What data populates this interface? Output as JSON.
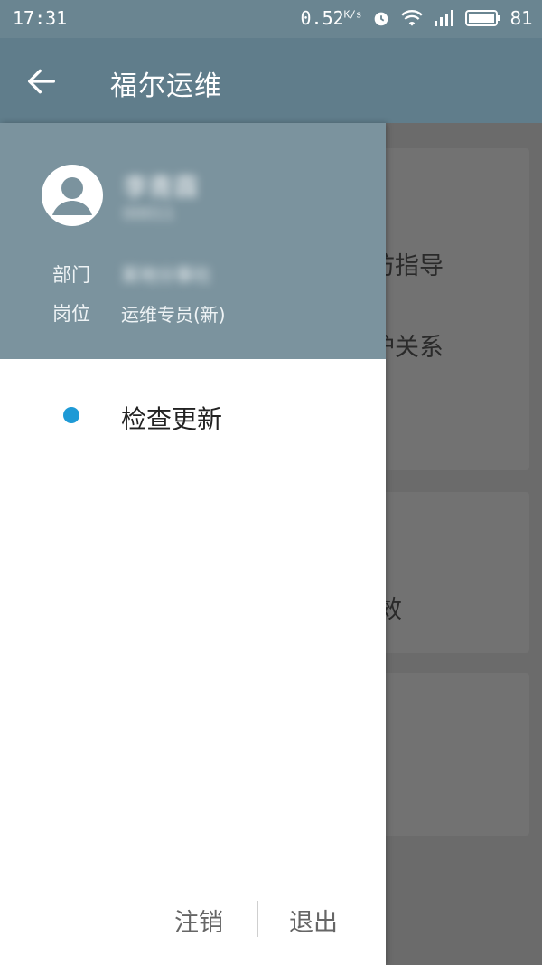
{
  "status_bar": {
    "time": "17:31",
    "speed": "0.52",
    "speed_unit": "K/s",
    "battery": "81"
  },
  "app_bar": {
    "title": "福尔运维"
  },
  "drawer": {
    "user": {
      "name": "李青霖",
      "id": "00011"
    },
    "department_label": "部门",
    "department_value": "某地分事社",
    "position_label": "岗位",
    "position_value": "运维专员(新)",
    "menu": [
      {
        "label": "检查更新",
        "icon": "dot-icon"
      }
    ],
    "footer": {
      "logout_label": "注销",
      "exit_label": "退出"
    }
  },
  "background_page": {
    "texts": [
      "访指导",
      "护关系",
      "效"
    ]
  },
  "colors": {
    "app_bar": "#607d8b",
    "drawer_header": "#7b939e",
    "accent_dot": "#1e9ad6"
  }
}
